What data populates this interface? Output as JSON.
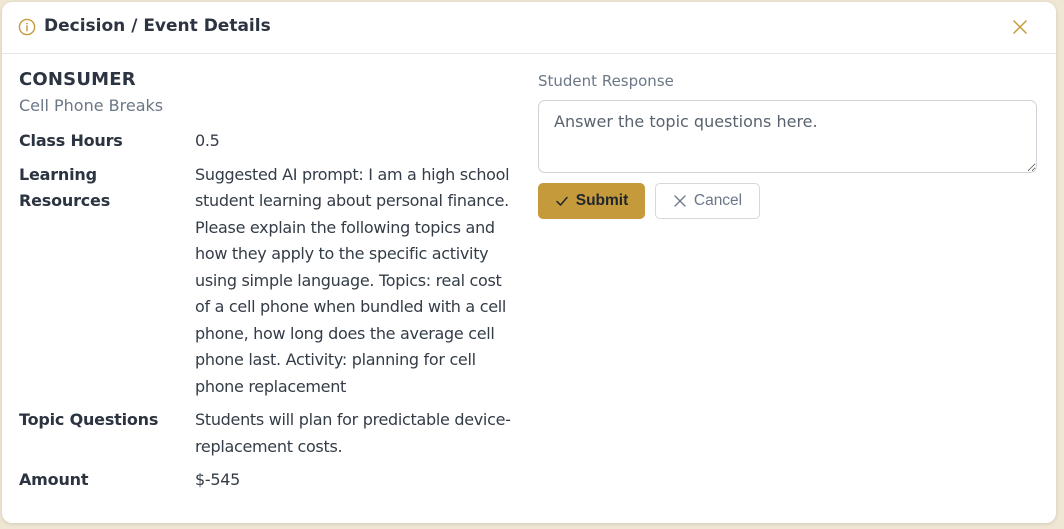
{
  "colors": {
    "accent": "#c49a3a",
    "heading": "#2b3440",
    "muted": "#6b7787",
    "backdrop": "#efe6d3"
  },
  "dialog": {
    "title": "Decision / Event Details",
    "title_icon": "info-icon",
    "close_icon": "close-icon"
  },
  "event": {
    "category": "CONSUMER",
    "name": "Cell Phone Breaks",
    "details": [
      {
        "label": "Class Hours",
        "value": "0.5"
      },
      {
        "label": "Learning Resources",
        "value": "Suggested AI prompt: I am a high school student learning about personal finance. Please explain the following topics and how they apply to the specific activity using simple language. Topics: real cost of a cell phone when bundled with a cell phone, how long does the average cell phone last. Activity: planning for cell phone replacement"
      },
      {
        "label": "Topic Questions",
        "value": "Students will plan for predictable device-replacement costs."
      },
      {
        "label": "Amount",
        "value": "$-545"
      }
    ]
  },
  "response": {
    "label": "Student Response",
    "placeholder": "Answer the topic questions here.",
    "value": "",
    "submit_label": "Submit",
    "submit_icon": "check-icon",
    "cancel_label": "Cancel",
    "cancel_icon": "x-icon"
  }
}
